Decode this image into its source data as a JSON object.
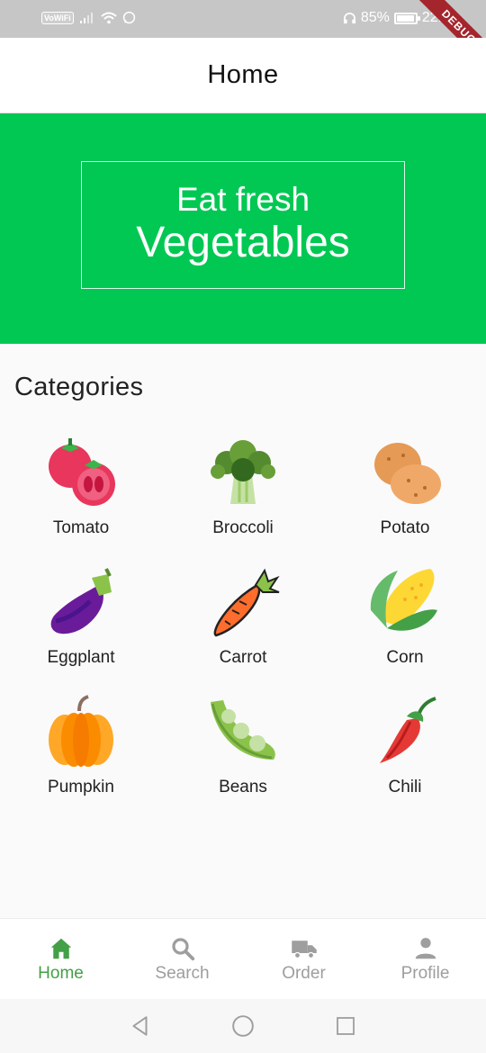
{
  "status_bar": {
    "network_label": "VoWiFi",
    "battery_percent": "85%",
    "battery_level": 0.85,
    "time": "22:3",
    "icons": [
      "signal-icon",
      "wifi-icon",
      "whatsapp-icon",
      "headset-icon",
      "battery-icon"
    ]
  },
  "debug_banner": "DEBUG",
  "app_bar": {
    "title": "Home"
  },
  "hero": {
    "line1": "Eat fresh",
    "line2": "Vegetables",
    "background": "#00c853"
  },
  "categories": {
    "title": "Categories",
    "items": [
      {
        "label": "Tomato",
        "icon": "tomato-icon"
      },
      {
        "label": "Broccoli",
        "icon": "broccoli-icon"
      },
      {
        "label": "Potato",
        "icon": "potato-icon"
      },
      {
        "label": "Eggplant",
        "icon": "eggplant-icon"
      },
      {
        "label": "Carrot",
        "icon": "carrot-icon"
      },
      {
        "label": "Corn",
        "icon": "corn-icon"
      },
      {
        "label": "Pumpkin",
        "icon": "pumpkin-icon"
      },
      {
        "label": "Beans",
        "icon": "beans-icon"
      },
      {
        "label": "Chili",
        "icon": "chili-icon"
      }
    ]
  },
  "bottom_nav": {
    "active_color": "#43a047",
    "inactive_color": "#9e9e9e",
    "items": [
      {
        "label": "Home",
        "icon": "home-icon",
        "active": true
      },
      {
        "label": "Search",
        "icon": "search-icon",
        "active": false
      },
      {
        "label": "Order",
        "icon": "truck-icon",
        "active": false
      },
      {
        "label": "Profile",
        "icon": "person-icon",
        "active": false
      }
    ]
  },
  "system_nav": {
    "icons": [
      "back-icon",
      "home-circle-icon",
      "recents-icon"
    ]
  }
}
